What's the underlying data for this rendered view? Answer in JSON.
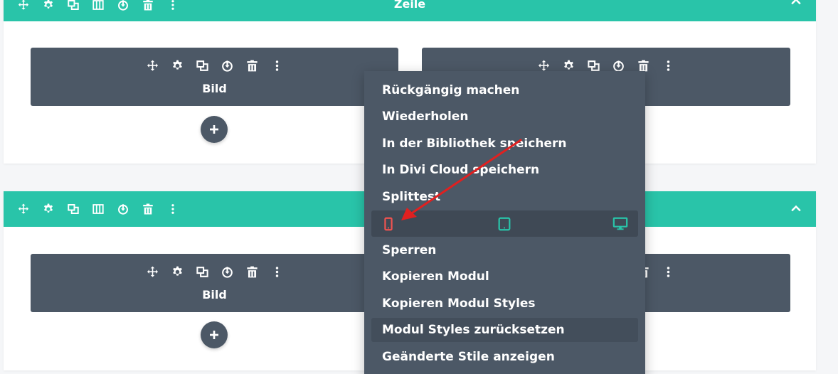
{
  "rows": [
    {
      "title": "Zeile",
      "modules": [
        {
          "label": "Bild"
        },
        {
          "label": ""
        }
      ]
    },
    {
      "title": "",
      "modules": [
        {
          "label": "Bild"
        },
        {
          "label": ""
        }
      ]
    }
  ],
  "context_menu": {
    "items": [
      {
        "label": "Rückgängig machen"
      },
      {
        "label": "Wiederholen"
      },
      {
        "label": "In der Bibliothek speichern"
      },
      {
        "label": "In Divi Cloud speichern"
      },
      {
        "label": "Splittest"
      },
      {
        "label": "Sperren"
      },
      {
        "label": "Kopieren Modul"
      },
      {
        "label": "Kopieren Modul Styles"
      },
      {
        "label": "Modul Styles zurücksetzen"
      },
      {
        "label": "Geänderte Stile anzeigen"
      }
    ],
    "devices": [
      "phone-icon",
      "tablet-icon",
      "desktop-icon"
    ]
  },
  "colors": {
    "row_header": "#29c4a9",
    "module_bg": "#4c5866",
    "menu_bg": "#4c5866",
    "phone_active": "#ef5350",
    "device_icon": "#29c4a9",
    "arrow": "#e02020"
  }
}
